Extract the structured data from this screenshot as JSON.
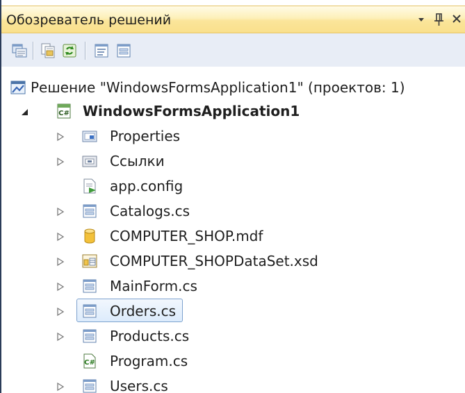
{
  "panel": {
    "title": "Обозреватель решений",
    "buttons": {
      "dropdown_glyph": "▼",
      "pin_glyph": "ᛋ",
      "close_glyph": "✕"
    }
  },
  "toolbar": {
    "items": [
      "properties-icon",
      "show-all-files-icon",
      "refresh-icon",
      "view-code-icon",
      "view-designer-icon"
    ]
  },
  "tree": {
    "solution": {
      "label": "Решение \"WindowsFormsApplication1\"  (проектов: 1)",
      "icon": "solution-icon"
    },
    "project": {
      "label": "WindowsFormsApplication1",
      "icon": "csharp-project-icon",
      "expanded": true
    },
    "items": [
      {
        "label": "Properties",
        "icon": "properties-folder-icon",
        "expandable": true
      },
      {
        "label": "Ссылки",
        "icon": "references-icon",
        "expandable": true
      },
      {
        "label": "app.config",
        "icon": "config-file-icon",
        "expandable": false
      },
      {
        "label": "Catalogs.cs",
        "icon": "form-icon",
        "expandable": true
      },
      {
        "label": "COMPUTER_SHOP.mdf",
        "icon": "database-icon",
        "expandable": true
      },
      {
        "label": "COMPUTER_SHOPDataSet.xsd",
        "icon": "dataset-icon",
        "expandable": true
      },
      {
        "label": "MainForm.cs",
        "icon": "form-icon",
        "expandable": true
      },
      {
        "label": "Orders.cs",
        "icon": "form-icon",
        "expandable": true,
        "selected": true
      },
      {
        "label": "Products.cs",
        "icon": "form-icon",
        "expandable": true
      },
      {
        "label": "Program.cs",
        "icon": "csharp-file-icon",
        "expandable": false
      },
      {
        "label": "Users.cs",
        "icon": "form-icon",
        "expandable": true
      }
    ]
  },
  "colors": {
    "title_bar": "#fbe59a",
    "toolbar": "#e8edf6",
    "selection_border": "#7da2ce"
  }
}
